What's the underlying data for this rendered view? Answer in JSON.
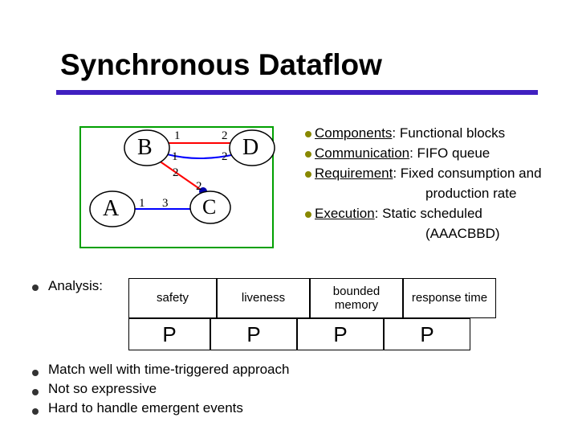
{
  "title": "Synchronous Dataflow",
  "diagram": {
    "nodes": {
      "A": "A",
      "B": "B",
      "C": "C",
      "D": "D"
    },
    "edge_labels": {
      "bd_src": "1",
      "bd_dst": "2",
      "bd2_src": "1",
      "bd2_dst": "2",
      "bc_src": "2",
      "bc_dst": "2",
      "ac_src": "1",
      "ac_dst": "3"
    }
  },
  "right_items": [
    {
      "label": "Components",
      "rest": ": Functional blocks"
    },
    {
      "label": "Communication",
      "rest": ": FIFO queue"
    },
    {
      "label": "Requirement",
      "rest": ": Fixed consumption and"
    },
    {
      "cont": "production rate"
    },
    {
      "label": "Execution",
      "rest": ": Static scheduled"
    },
    {
      "cont": "(AAACBBD)"
    }
  ],
  "analysis_label": "Analysis:",
  "table": {
    "headers": [
      "safety",
      "liveness",
      "bounded memory",
      "response time"
    ],
    "checks": [
      "P",
      "P",
      "P",
      "P"
    ]
  },
  "bottom": [
    "Match well with time-triggered approach",
    "Not so expressive",
    "Hard to handle emergent events"
  ]
}
